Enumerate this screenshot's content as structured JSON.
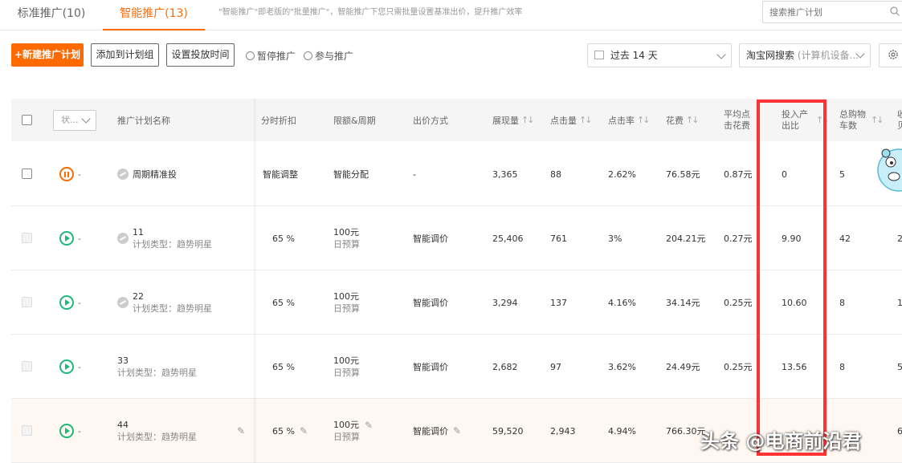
{
  "tabs": [
    {
      "label": "标准推广(10)"
    },
    {
      "label": "智能推广(13)"
    }
  ],
  "tab_description": "\"智能推广\"即老版的\"批量推广\"，智能推广下您只需批量设置基准出价，提升推广效率",
  "search": {
    "placeholder": "搜索推广计划"
  },
  "toolbar": {
    "new_plan": "+新建推广计划",
    "add_group": "添加到计划组",
    "set_time": "设置投放时间",
    "pause": "暂停推广",
    "join": "参与推广",
    "date_range": "过去 14 天",
    "channel": "淘宝网搜索",
    "channel_device": "(计算机设备..."
  },
  "colors": {
    "accent": "#ff6a00",
    "play": "#1db87a",
    "highlight_box": "#ff3333"
  },
  "columns": {
    "status": "状...",
    "name": "推广计划名称",
    "discount": "分时折扣",
    "budget": "限额&周期",
    "bidding": "出价方式",
    "impressions": "展现量",
    "clicks": "点击量",
    "ctr": "点击率",
    "cost": "花费",
    "cpc_l1": "平均点",
    "cpc_l2": "击花费",
    "roi_l1": "投入产",
    "roi_l2": "出比",
    "cart_l1": "总购物",
    "cart_l2": "车数",
    "more_l1": "收",
    "more_l2": "贝"
  },
  "rows": [
    {
      "status": "paused",
      "dash": "-",
      "name": "周期精准投",
      "type": "",
      "discount": "智能调整",
      "budget": "智能分配",
      "budget_sub": "",
      "bidding": "-",
      "impressions": "3,365",
      "clicks": "88",
      "ctr": "2.62%",
      "cost": "76.58元",
      "cpc": "0.87元",
      "roi": "0",
      "cart": "5",
      "more": ""
    },
    {
      "status": "active",
      "dash": "-",
      "name": "11",
      "type": "计划类型：趋势明星",
      "discount": "65 %",
      "budget": "100元",
      "budget_sub": "日预算",
      "bidding": "智能调价",
      "impressions": "25,406",
      "clicks": "761",
      "ctr": "3%",
      "cost": "204.21元",
      "cpc": "0.27元",
      "roi": "9.90",
      "cart": "42",
      "more": "2"
    },
    {
      "status": "active",
      "dash": "-",
      "name": "22",
      "type": "计划类型：趋势明星",
      "discount": "65 %",
      "budget": "100元",
      "budget_sub": "日预算",
      "bidding": "智能调价",
      "impressions": "3,294",
      "clicks": "137",
      "ctr": "4.16%",
      "cost": "34.14元",
      "cpc": "0.25元",
      "roi": "10.60",
      "cart": "8",
      "more": "1"
    },
    {
      "status": "active",
      "dash": "-",
      "name": "33",
      "type": "计划类型：趋势明星",
      "discount": "65 %",
      "budget": "100元",
      "budget_sub": "日预算",
      "bidding": "智能调价",
      "impressions": "2,682",
      "clicks": "97",
      "ctr": "3.62%",
      "cost": "24.49元",
      "cpc": "0.25元",
      "roi": "13.56",
      "cart": "8",
      "more": "5"
    },
    {
      "status": "active",
      "dash": "-",
      "name": "44",
      "type": "计划类型：趋势明星",
      "discount": "65 %",
      "budget": "100元",
      "budget_sub": "日预算",
      "bidding": "智能调价",
      "impressions": "59,520",
      "clicks": "2,943",
      "ctr": "4.94%",
      "cost": "766.30元",
      "cpc": "",
      "roi": "",
      "cart": "",
      "more": "6"
    }
  ],
  "watermark": "头条 @电商前沿君"
}
